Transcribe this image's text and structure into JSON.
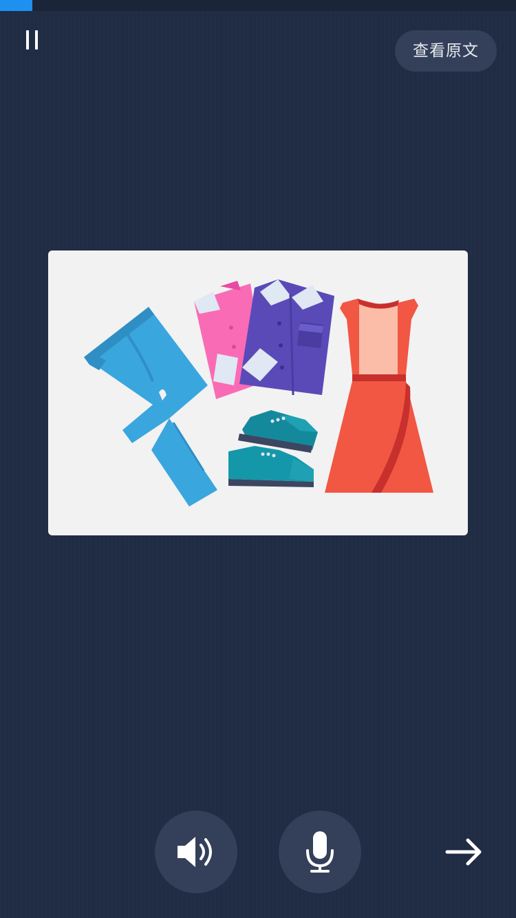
{
  "progress": {
    "value": 0.063,
    "fill_color": "#1e90f0"
  },
  "header": {
    "pause_icon": "pause-icon",
    "view_original_label": "查看原文"
  },
  "illustration": {
    "subject": "clothes",
    "items": [
      "jeans-icon",
      "pink-shirt-icon",
      "purple-shirt-icon",
      "teal-shoes-icon",
      "red-dress-icon"
    ]
  },
  "controls": {
    "speaker_icon": "speaker-icon",
    "mic_icon": "microphone-icon",
    "next_icon": "arrow-right-icon"
  },
  "colors": {
    "background": "#202c44",
    "button": "#34405a",
    "accent": "#1e90f0"
  }
}
